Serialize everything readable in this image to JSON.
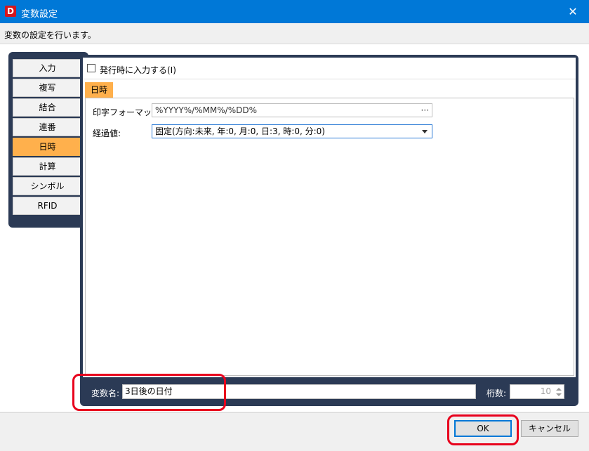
{
  "window": {
    "app_icon": "D",
    "title": "変数設定",
    "close_symbol": "✕",
    "description": "変数の設定を行います。"
  },
  "tabs": [
    {
      "label": "入力",
      "active": false
    },
    {
      "label": "複写",
      "active": false
    },
    {
      "label": "結合",
      "active": false
    },
    {
      "label": "連番",
      "active": false
    },
    {
      "label": "日時",
      "active": true
    },
    {
      "label": "計算",
      "active": false
    },
    {
      "label": "シンボル",
      "active": false
    },
    {
      "label": "RFID",
      "active": false
    }
  ],
  "issue_checkbox": {
    "label": "発行時に入力する(I)",
    "checked": false
  },
  "datetime": {
    "tab_label": "日時",
    "format_label": "印字フォーマット:",
    "format_value": "%YYYY%/%MM%/%DD%",
    "format_button": "···",
    "elapsed_label": "経過値:",
    "elapsed_value": "固定(方向:未来, 年:0, 月:0, 日:3, 時:0, 分:0)"
  },
  "bottom": {
    "name_label": "変数名:",
    "name_value": "3日後の日付",
    "digits_label": "桁数:",
    "digits_value": "10"
  },
  "buttons": {
    "ok": "OK",
    "cancel": "キャンセル"
  },
  "colors": {
    "titlebar": "#0078d7",
    "panel": "#2b3a55",
    "active_tab": "#ffb04c",
    "annotation": "#e8001c"
  }
}
